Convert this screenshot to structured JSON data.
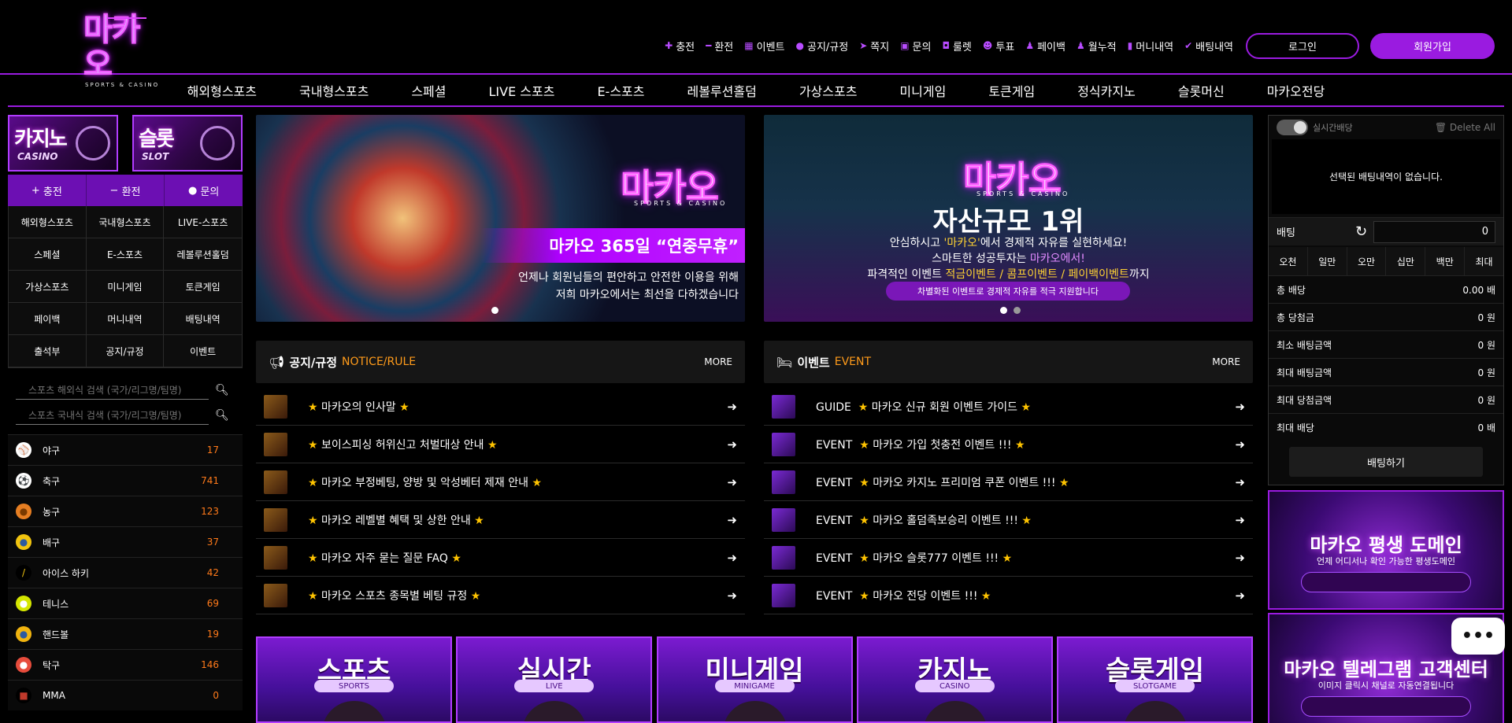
{
  "logo": {
    "main": "마카오",
    "sub": "SPORTS & CASINO"
  },
  "topnav": [
    {
      "label": "충전",
      "icon": "plus-icon"
    },
    {
      "label": "환전",
      "icon": "minus-icon"
    },
    {
      "label": "이벤트",
      "icon": "calendar-icon"
    },
    {
      "label": "공지/규정",
      "icon": "info-icon"
    },
    {
      "label": "쪽지",
      "icon": "send-icon"
    },
    {
      "label": "문의",
      "icon": "edit-icon"
    },
    {
      "label": "룰렛",
      "icon": "gift-icon"
    },
    {
      "label": "투표",
      "icon": "users-icon"
    },
    {
      "label": "페이백",
      "icon": "user-icon"
    },
    {
      "label": "월누적",
      "icon": "user-icon"
    },
    {
      "label": "머니내역",
      "icon": "wallet-icon"
    },
    {
      "label": "배팅내역",
      "icon": "check-icon"
    }
  ],
  "auth": {
    "login": "로그인",
    "join": "회원가입"
  },
  "mainnav": [
    "해외형스포츠",
    "국내형스포츠",
    "스페셜",
    "LIVE 스포츠",
    "E-스포츠",
    "레볼루션홀덤",
    "가상스포츠",
    "미니게임",
    "토큰게임",
    "정식카지노",
    "슬롯머신",
    "마카오전당"
  ],
  "tiles": [
    {
      "big": "카지노",
      "small": "CASINO"
    },
    {
      "big": "슬롯",
      "small": "SLOT"
    }
  ],
  "quick": [
    {
      "label": "충전",
      "icon": "+"
    },
    {
      "label": "환전",
      "icon": "−"
    },
    {
      "label": "문의",
      "icon": "●"
    }
  ],
  "leftgrid": [
    "해외형스포츠",
    "국내형스포츠",
    "LIVE-스포츠",
    "스페셜",
    "E-스포츠",
    "레볼루션홀덤",
    "가상스포츠",
    "미니게임",
    "토큰게임",
    "페이백",
    "머니내역",
    "배팅내역",
    "출석부",
    "공지/규정",
    "이벤트"
  ],
  "search": {
    "overseas_placeholder": "스포츠 해외식 검색 (국가/리그명/팀명)",
    "domestic_placeholder": "스포츠 국내식 검색 (국가/리그명/팀명)"
  },
  "sports": [
    {
      "name": "야구",
      "count": "17",
      "glyph": "⚾",
      "bg": "#ffffff",
      "color": "#c0392b"
    },
    {
      "name": "축구",
      "count": "741",
      "glyph": "⚽",
      "bg": "#ffffff",
      "color": "#111111"
    },
    {
      "name": "농구",
      "count": "123",
      "glyph": "●",
      "bg": "#e67e22",
      "color": "#7a3a00"
    },
    {
      "name": "배구",
      "count": "37",
      "glyph": "●",
      "bg": "#f1c40f",
      "color": "#2c5aa0"
    },
    {
      "name": "아이스 하키",
      "count": "42",
      "glyph": "/",
      "bg": "#000000",
      "color": "#f1c40f"
    },
    {
      "name": "테니스",
      "count": "69",
      "glyph": "●",
      "bg": "#d4e600",
      "color": "#ffffff"
    },
    {
      "name": "핸드볼",
      "count": "19",
      "glyph": "●",
      "bg": "#f1b40f",
      "color": "#2c5aa0"
    },
    {
      "name": "탁구",
      "count": "146",
      "glyph": "●",
      "bg": "#e74c3c",
      "color": "#ffffff"
    },
    {
      "name": "MMA",
      "count": "0",
      "glyph": "■",
      "bg": "#000000",
      "color": "#c0392b"
    }
  ],
  "banner1": {
    "logo": "마카오",
    "logo_sub": "SPORTS & CASINO",
    "headline": "마카오 365일 “연중무휴”",
    "line1": "언제나 회원님들의 편안하고 안전한 이용을 위해",
    "line2": "저희 마카오에서는 최선을 다하겠습니다"
  },
  "banner2": {
    "logo": "마카오",
    "logo_sub": "SPORTS & CASINO",
    "title": "자산규모 1위",
    "l1a": "안심하시고 ",
    "l1b": "'마카오'",
    "l1c": "에서 경제적 자유를 실현하세요!",
    "l2a": "스마트한 성공투자는 ",
    "l2b": "마카오에서!",
    "l3a": "파격적인 이벤트 ",
    "l3b": "적금이벤트 / 콤프이벤트 / 페이백이벤트",
    "l3c": "까지",
    "pill": "차별화된 이벤트로 경제적 자유를 적극 지원합니다"
  },
  "notice": {
    "title": "공지/규정",
    "en": "NOTICE/RULE",
    "more": "MORE",
    "rows": [
      "마카오의 인사말",
      "보이스피싱 허위신고 처벌대상 안내",
      "마카오 부정베팅, 양방 및 악성베터 제재 안내",
      "마카오 레벨별 혜택 및 상한 안내",
      "마카오 자주 묻는 질문 FAQ",
      "마카오 스포츠 종목별 베팅 규정"
    ]
  },
  "event": {
    "title": "이벤트",
    "en": "EVENT",
    "more": "MORE",
    "rows": [
      {
        "tag": "GUIDE",
        "text": "마카오 신규 회원 이벤트 가이드"
      },
      {
        "tag": "EVENT",
        "text": "마카오 가입 첫충전 이벤트 !!!"
      },
      {
        "tag": "EVENT",
        "text": "마카오 카지노 프리미엄 쿠폰 이벤트 !!!"
      },
      {
        "tag": "EVENT",
        "text": "마카오 홀덤족보승리 이벤트 !!!"
      },
      {
        "tag": "EVENT",
        "text": "마카오 슬롯777 이벤트 !!!"
      },
      {
        "tag": "EVENT",
        "text": "마카오 전당 이벤트 !!!"
      }
    ]
  },
  "betslip": {
    "toggle_label": "실시간배당",
    "delete_all": "Delete All",
    "empty": "선택된 배팅내역이 없습니다.",
    "bet_label": "배팅",
    "bet_amount": "0",
    "chips": [
      "오천",
      "일만",
      "오만",
      "십만",
      "백만",
      "최대"
    ],
    "summary": [
      {
        "label": "총 배당",
        "value": "0.00 배"
      },
      {
        "label": "총 당첨금",
        "value": "0 원"
      },
      {
        "label": "최소 배팅금액",
        "value": "0 원"
      },
      {
        "label": "최대 배팅금액",
        "value": "0 원"
      },
      {
        "label": "최대 당첨금액",
        "value": "0 원"
      },
      {
        "label": "최대 배당",
        "value": "0 배"
      }
    ],
    "submit": "배팅하기"
  },
  "promo1": {
    "title": "마카오 평생 도메인",
    "sub": "언제 어디서나 확인 가능한 평생도메인"
  },
  "promo2": {
    "title": "마카오 텔레그램 고객센터",
    "sub": "이미지 클릭시 채널로 자동연결됩니다"
  },
  "chat_label": "•••",
  "categories": [
    {
      "title": "스포츠",
      "sub": "SPORTS"
    },
    {
      "title": "실시간",
      "sub": "LIVE"
    },
    {
      "title": "미니게임",
      "sub": "MINIGAME"
    },
    {
      "title": "카지노",
      "sub": "CASINO"
    },
    {
      "title": "슬롯게임",
      "sub": "SLOTGAME"
    }
  ],
  "colors": {
    "accent": "#9a1be0",
    "count": "#ff7a1a",
    "notice_en": "#ff9b1a",
    "star": "#ffc400"
  }
}
